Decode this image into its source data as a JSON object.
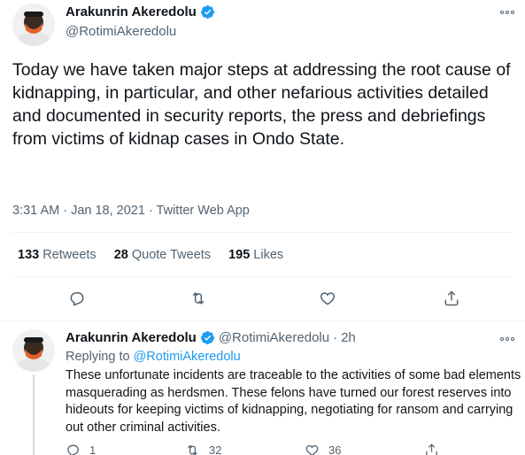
{
  "main_tweet": {
    "display_name": "Arakunrin Akeredolu",
    "handle": "@RotimiAkeredolu",
    "text": "Today we have taken major steps at addressing the root cause of kidnapping, in particular, and other nefarious activities detailed and documented in security reports, the press and debriefings from victims of kidnap cases in Ondo State.",
    "timestamp": "3:31 AM · Jan 18, 2021 · Twitter Web App",
    "stats": [
      {
        "count": "133",
        "label": "Retweets"
      },
      {
        "count": "28",
        "label": "Quote Tweets"
      },
      {
        "count": "195",
        "label": "Likes"
      }
    ],
    "actions": [
      "reply-icon",
      "retweet-icon",
      "like-icon",
      "share-icon"
    ]
  },
  "reply_tweet": {
    "display_name": "Arakunrin Akeredolu",
    "handle": "@RotimiAkeredolu",
    "separator": "·",
    "time": "2h",
    "replying_prefix": "Replying to",
    "replying_handle": "@RotimiAkeredolu",
    "text": "These unfortunate incidents are traceable to the activities of some bad elements masquerading as herdsmen.   These felons have turned our forest reserves into hideouts for keeping victims of kidnapping, negotiating for ransom and carrying out other criminal activities.",
    "reply_count": "1",
    "retweet_count": "32",
    "like_count": "36"
  },
  "colors": {
    "accent": "#1d9bf0",
    "text": "#0f1419",
    "secondary": "#536471",
    "avatar_mask": "#e0632c"
  }
}
